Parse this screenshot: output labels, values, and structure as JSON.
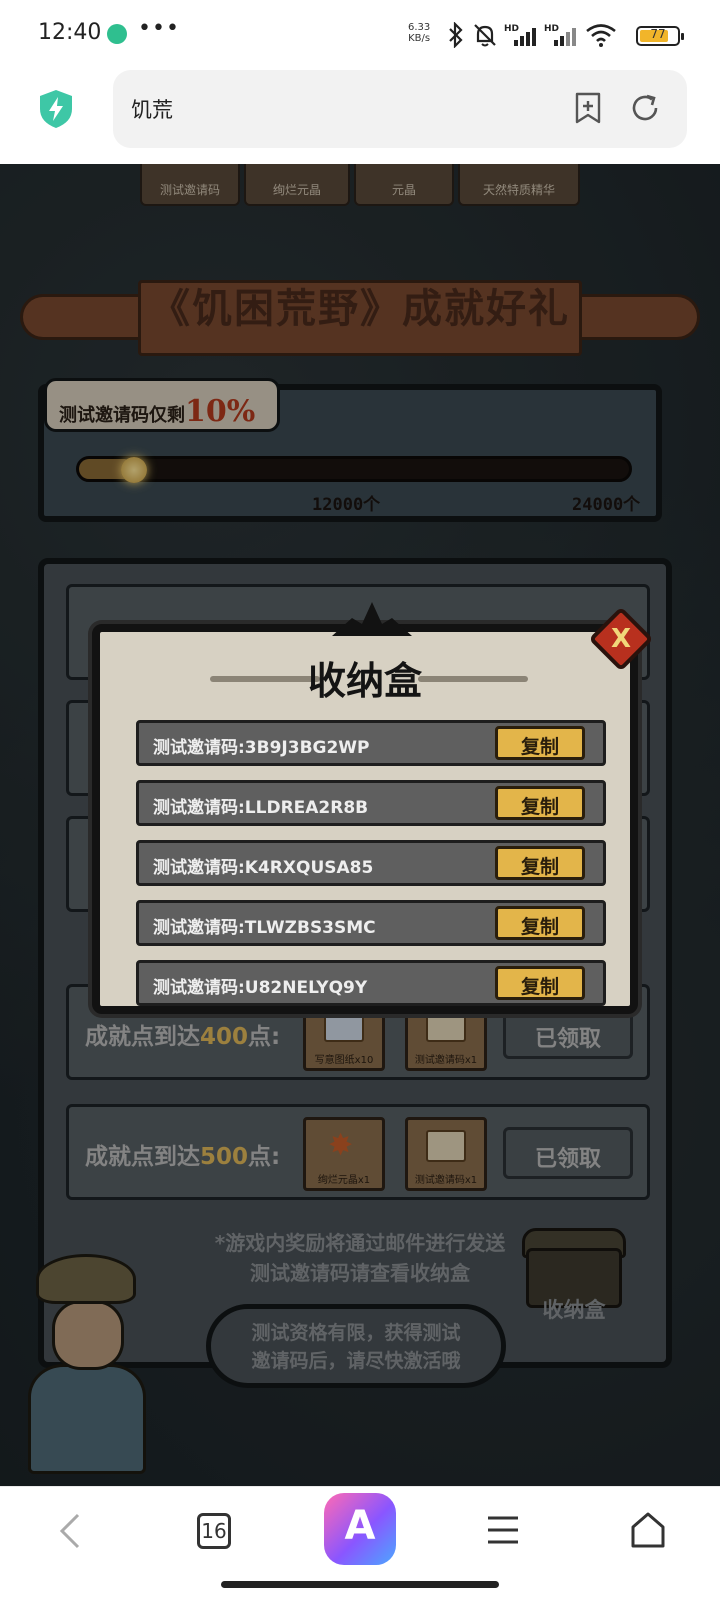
{
  "status_bar": {
    "time": "12:40",
    "more": "•••",
    "net_speed_value": "6.33",
    "net_speed_unit": "KB/s",
    "battery_percent": "77",
    "battery_level": 0.77
  },
  "browser": {
    "address_text": "饥荒"
  },
  "page": {
    "top_rewards": [
      "测试邀请码",
      "绚烂元晶",
      "元晶",
      "天然特质精华"
    ],
    "banner_title": "《饥困荒野》成就好礼",
    "progress": {
      "label": "测试邀请码仅剩",
      "percent_label": "10%",
      "fill_fraction": 0.1,
      "ticks": [
        "12000个",
        "24000个"
      ]
    },
    "tasks": [
      {
        "label_prefix": "成就点到达",
        "points": "400",
        "label_suffix": "点:",
        "items": [
          "写意图纸x10",
          "测试邀请码x1"
        ],
        "button": "已领取"
      },
      {
        "label_prefix": "成就点到达",
        "points": "500",
        "label_suffix": "点:",
        "items": [
          "绚烂元晶x1",
          "测试邀请码x1"
        ],
        "button": "已领取"
      }
    ],
    "notice_line1": "*游戏内奖励将通过邮件进行发送",
    "notice_line2": "测试邀请码请查看收纳盒",
    "chest_label": "收纳盒",
    "speech_line1": "测试资格有限，获得测试",
    "speech_line2": "邀请码后，请尽快激活哦"
  },
  "modal": {
    "title": "收纳盒",
    "close_label": "X",
    "codes": [
      {
        "text": "测试邀请码:3B9J3BG2WP",
        "button": "复制"
      },
      {
        "text": "测试邀请码:LLDREA2R8B",
        "button": "复制"
      },
      {
        "text": "测试邀请码:K4RXQUSA85",
        "button": "复制"
      },
      {
        "text": "测试邀请码:TLWZBS3SMC",
        "button": "复制"
      },
      {
        "text": "测试邀请码:U82NELYQ9Y",
        "button": "复制"
      }
    ]
  },
  "bottom_nav": {
    "tabs_count": "16",
    "ai_glyph": "A"
  },
  "colors": {
    "page_bg": "#1c2428",
    "accent_gold": "#e3b54a",
    "close_red": "#b8301e",
    "progress_red": "#b33a1e"
  }
}
